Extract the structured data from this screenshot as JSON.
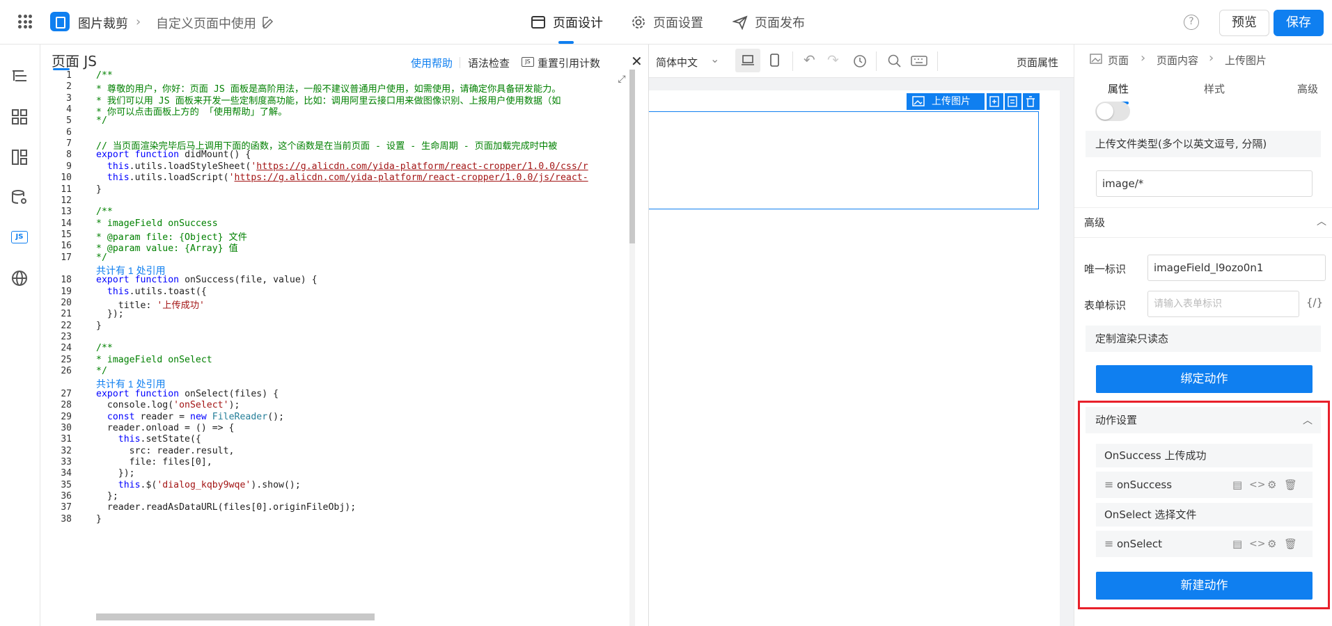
{
  "topbar": {
    "app_name": "图片裁剪",
    "page_name": "自定义页面中使用",
    "tabs": [
      {
        "label": "页面设计",
        "active": true
      },
      {
        "label": "页面设置",
        "active": false
      },
      {
        "label": "页面发布",
        "active": false
      }
    ],
    "help_icon": "?",
    "preview_label": "预览",
    "save_label": "保存"
  },
  "js_panel": {
    "title": "页面 JS",
    "help_link": "使用帮助",
    "lint": "语法检查",
    "reset_refs": "重置引用计数",
    "ref_notes": [
      "共计有 1 处引用",
      "共计有 1 处引用"
    ]
  },
  "code_lines": [
    {
      "n": "1",
      "text": "/**"
    },
    {
      "n": "2",
      "text": "* 尊敬的用户，你好：页面 JS 面板是高阶用法，一般不建议普通用户使用，如需使用，请确定你具备研发能力。"
    },
    {
      "n": "3",
      "text": "* 我们可以用 JS 面板来开发一些定制度高功能，比如：调用阿里云接口用来做图像识别、上报用户使用数据（如"
    },
    {
      "n": "4",
      "text": "* 你可以点击面板上方的 「使用帮助」了解。"
    },
    {
      "n": "5",
      "text": "*/"
    },
    {
      "n": "6",
      "text": ""
    },
    {
      "n": "7",
      "text": "// 当页面渲染完毕后马上调用下面的函数，这个函数是在当前页面 - 设置 - 生命周期 - 页面加载完成时中被"
    },
    {
      "n": "8",
      "text": "export function didMount() {"
    },
    {
      "n": "9",
      "text": "  this.utils.loadStyleSheet('https://g.alicdn.com/yida-platform/react-cropper/1.0.0/css/r"
    },
    {
      "n": "10",
      "text": "  this.utils.loadScript('https://g.alicdn.com/yida-platform/react-cropper/1.0.0/js/react-"
    },
    {
      "n": "11",
      "text": "}"
    },
    {
      "n": "12",
      "text": ""
    },
    {
      "n": "13",
      "text": "/**"
    },
    {
      "n": "14",
      "text": "* imageField onSuccess"
    },
    {
      "n": "15",
      "text": "* @param file: {Object} 文件"
    },
    {
      "n": "16",
      "text": "* @param value: {Array} 值"
    },
    {
      "n": "17",
      "text": "*/"
    },
    {
      "n": "18",
      "text": "export function onSuccess(file, value) {"
    },
    {
      "n": "19",
      "text": "  this.utils.toast({"
    },
    {
      "n": "20",
      "text": "    title: '上传成功'"
    },
    {
      "n": "21",
      "text": "  });"
    },
    {
      "n": "22",
      "text": "}"
    },
    {
      "n": "23",
      "text": ""
    },
    {
      "n": "24",
      "text": "/**"
    },
    {
      "n": "25",
      "text": "* imageField onSelect"
    },
    {
      "n": "26",
      "text": "*/"
    },
    {
      "n": "27",
      "text": "export function onSelect(files) {"
    },
    {
      "n": "28",
      "text": "  console.log('onSelect');"
    },
    {
      "n": "29",
      "text": "  const reader = new FileReader();"
    },
    {
      "n": "30",
      "text": "  reader.onload = () => {"
    },
    {
      "n": "31",
      "text": "    this.setState({"
    },
    {
      "n": "32",
      "text": "      src: reader.result,"
    },
    {
      "n": "33",
      "text": "      file: files[0],"
    },
    {
      "n": "34",
      "text": "    });"
    },
    {
      "n": "35",
      "text": "    this.$('dialog_kqby9wqe').show();"
    },
    {
      "n": "36",
      "text": "  };"
    },
    {
      "n": "37",
      "text": "  reader.readAsDataURL(files[0].originFileObj);"
    },
    {
      "n": "38",
      "text": "}"
    }
  ],
  "canvas": {
    "lang": "简体中文",
    "page_props": "页面属性",
    "upload_button": "上传图片"
  },
  "props": {
    "breadcrumb": [
      "页面",
      "页面内容",
      "上传图片"
    ],
    "tabs": [
      "属性",
      "样式",
      "高级"
    ],
    "upload_type_label": "上传文件类型(多个以英文逗号, 分隔)",
    "upload_type_value": "image/*",
    "advanced_header": "高级",
    "unique_id_label": "唯一标识",
    "unique_id_value": "imageField_l9ozo0n1",
    "form_id_label": "表单标识",
    "form_id_placeholder": "请输入表单标识",
    "form_id_var": "{/}",
    "custom_render": "定制渲染只读态",
    "bind_action": "绑定动作",
    "action_header": "动作设置",
    "actions": [
      {
        "event": "OnSuccess 上传成功",
        "handler": "onSuccess"
      },
      {
        "event": "OnSelect 选择文件",
        "handler": "onSelect"
      }
    ],
    "new_action": "新建动作"
  },
  "colors": {
    "primary": "#0f7ff0",
    "highlight": "#e8202a"
  }
}
